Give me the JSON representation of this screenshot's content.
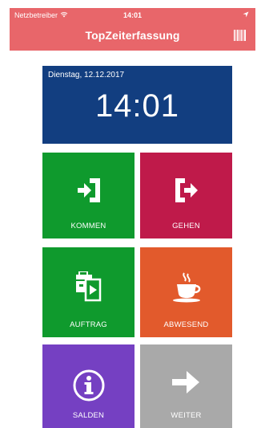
{
  "status_bar": {
    "carrier": "Netzbetreiber",
    "wifi_icon": "wifi-icon",
    "time": "14:01",
    "location_icon": "location-arrow-icon"
  },
  "header": {
    "title": "TopZeiterfassung",
    "barcode_icon": "barcode-icon"
  },
  "clock": {
    "date": "Dienstag, 12.12.2017",
    "time": "14:01",
    "color": "#123e80"
  },
  "tiles": [
    {
      "label": "KOMMEN",
      "icon": "enter-icon",
      "color": "#0f9a2d"
    },
    {
      "label": "GEHEN",
      "icon": "exit-icon",
      "color": "#bf1a4a"
    },
    {
      "label": "AUFTRAG",
      "icon": "task-icon",
      "color": "#0f9a2d"
    },
    {
      "label": "ABWESEND",
      "icon": "coffee-cup-icon",
      "color": "#e25a2c"
    },
    {
      "label": "SALDEN",
      "icon": "info-icon",
      "color": "#7540c2"
    },
    {
      "label": "WEITER",
      "icon": "arrow-right-icon",
      "color": "#a9a9a9"
    }
  ],
  "accent": "#e8666a"
}
